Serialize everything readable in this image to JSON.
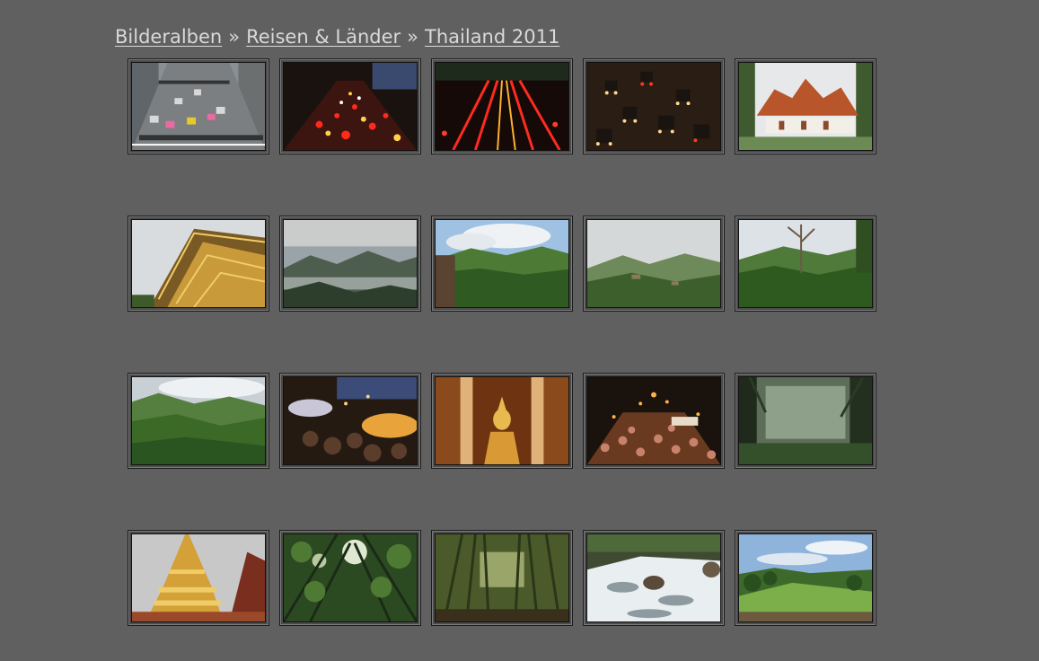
{
  "breadcrumb": {
    "items": [
      {
        "label": "Bilderalben"
      },
      {
        "label": "Reisen & Länder"
      },
      {
        "label": "Thailand 2011"
      }
    ],
    "separator": "»"
  },
  "colors": {
    "background": "#606060",
    "link": "#d9d9d9",
    "thumb_border": "#1c1c1c"
  },
  "gallery": {
    "columns": 5,
    "photos": [
      {
        "name": "photo-street-traffic-day"
      },
      {
        "name": "photo-traffic-night-red-lights"
      },
      {
        "name": "photo-traffic-light-trails"
      },
      {
        "name": "photo-traffic-jam-evening"
      },
      {
        "name": "photo-temple-orange-roof"
      },
      {
        "name": "photo-temple-gable-gold"
      },
      {
        "name": "photo-misty-mountains"
      },
      {
        "name": "photo-forest-hill-hut"
      },
      {
        "name": "photo-foggy-hillside"
      },
      {
        "name": "photo-jungle-hill-tree"
      },
      {
        "name": "photo-green-valley-clouds"
      },
      {
        "name": "photo-night-market-umbrellas"
      },
      {
        "name": "photo-golden-buddha"
      },
      {
        "name": "photo-night-market-crowd"
      },
      {
        "name": "photo-misty-forest"
      },
      {
        "name": "photo-golden-chedi"
      },
      {
        "name": "photo-tree-canopy"
      },
      {
        "name": "photo-bamboo-forest"
      },
      {
        "name": "photo-waterfall-rapids"
      },
      {
        "name": "photo-garden-landscape"
      }
    ]
  }
}
